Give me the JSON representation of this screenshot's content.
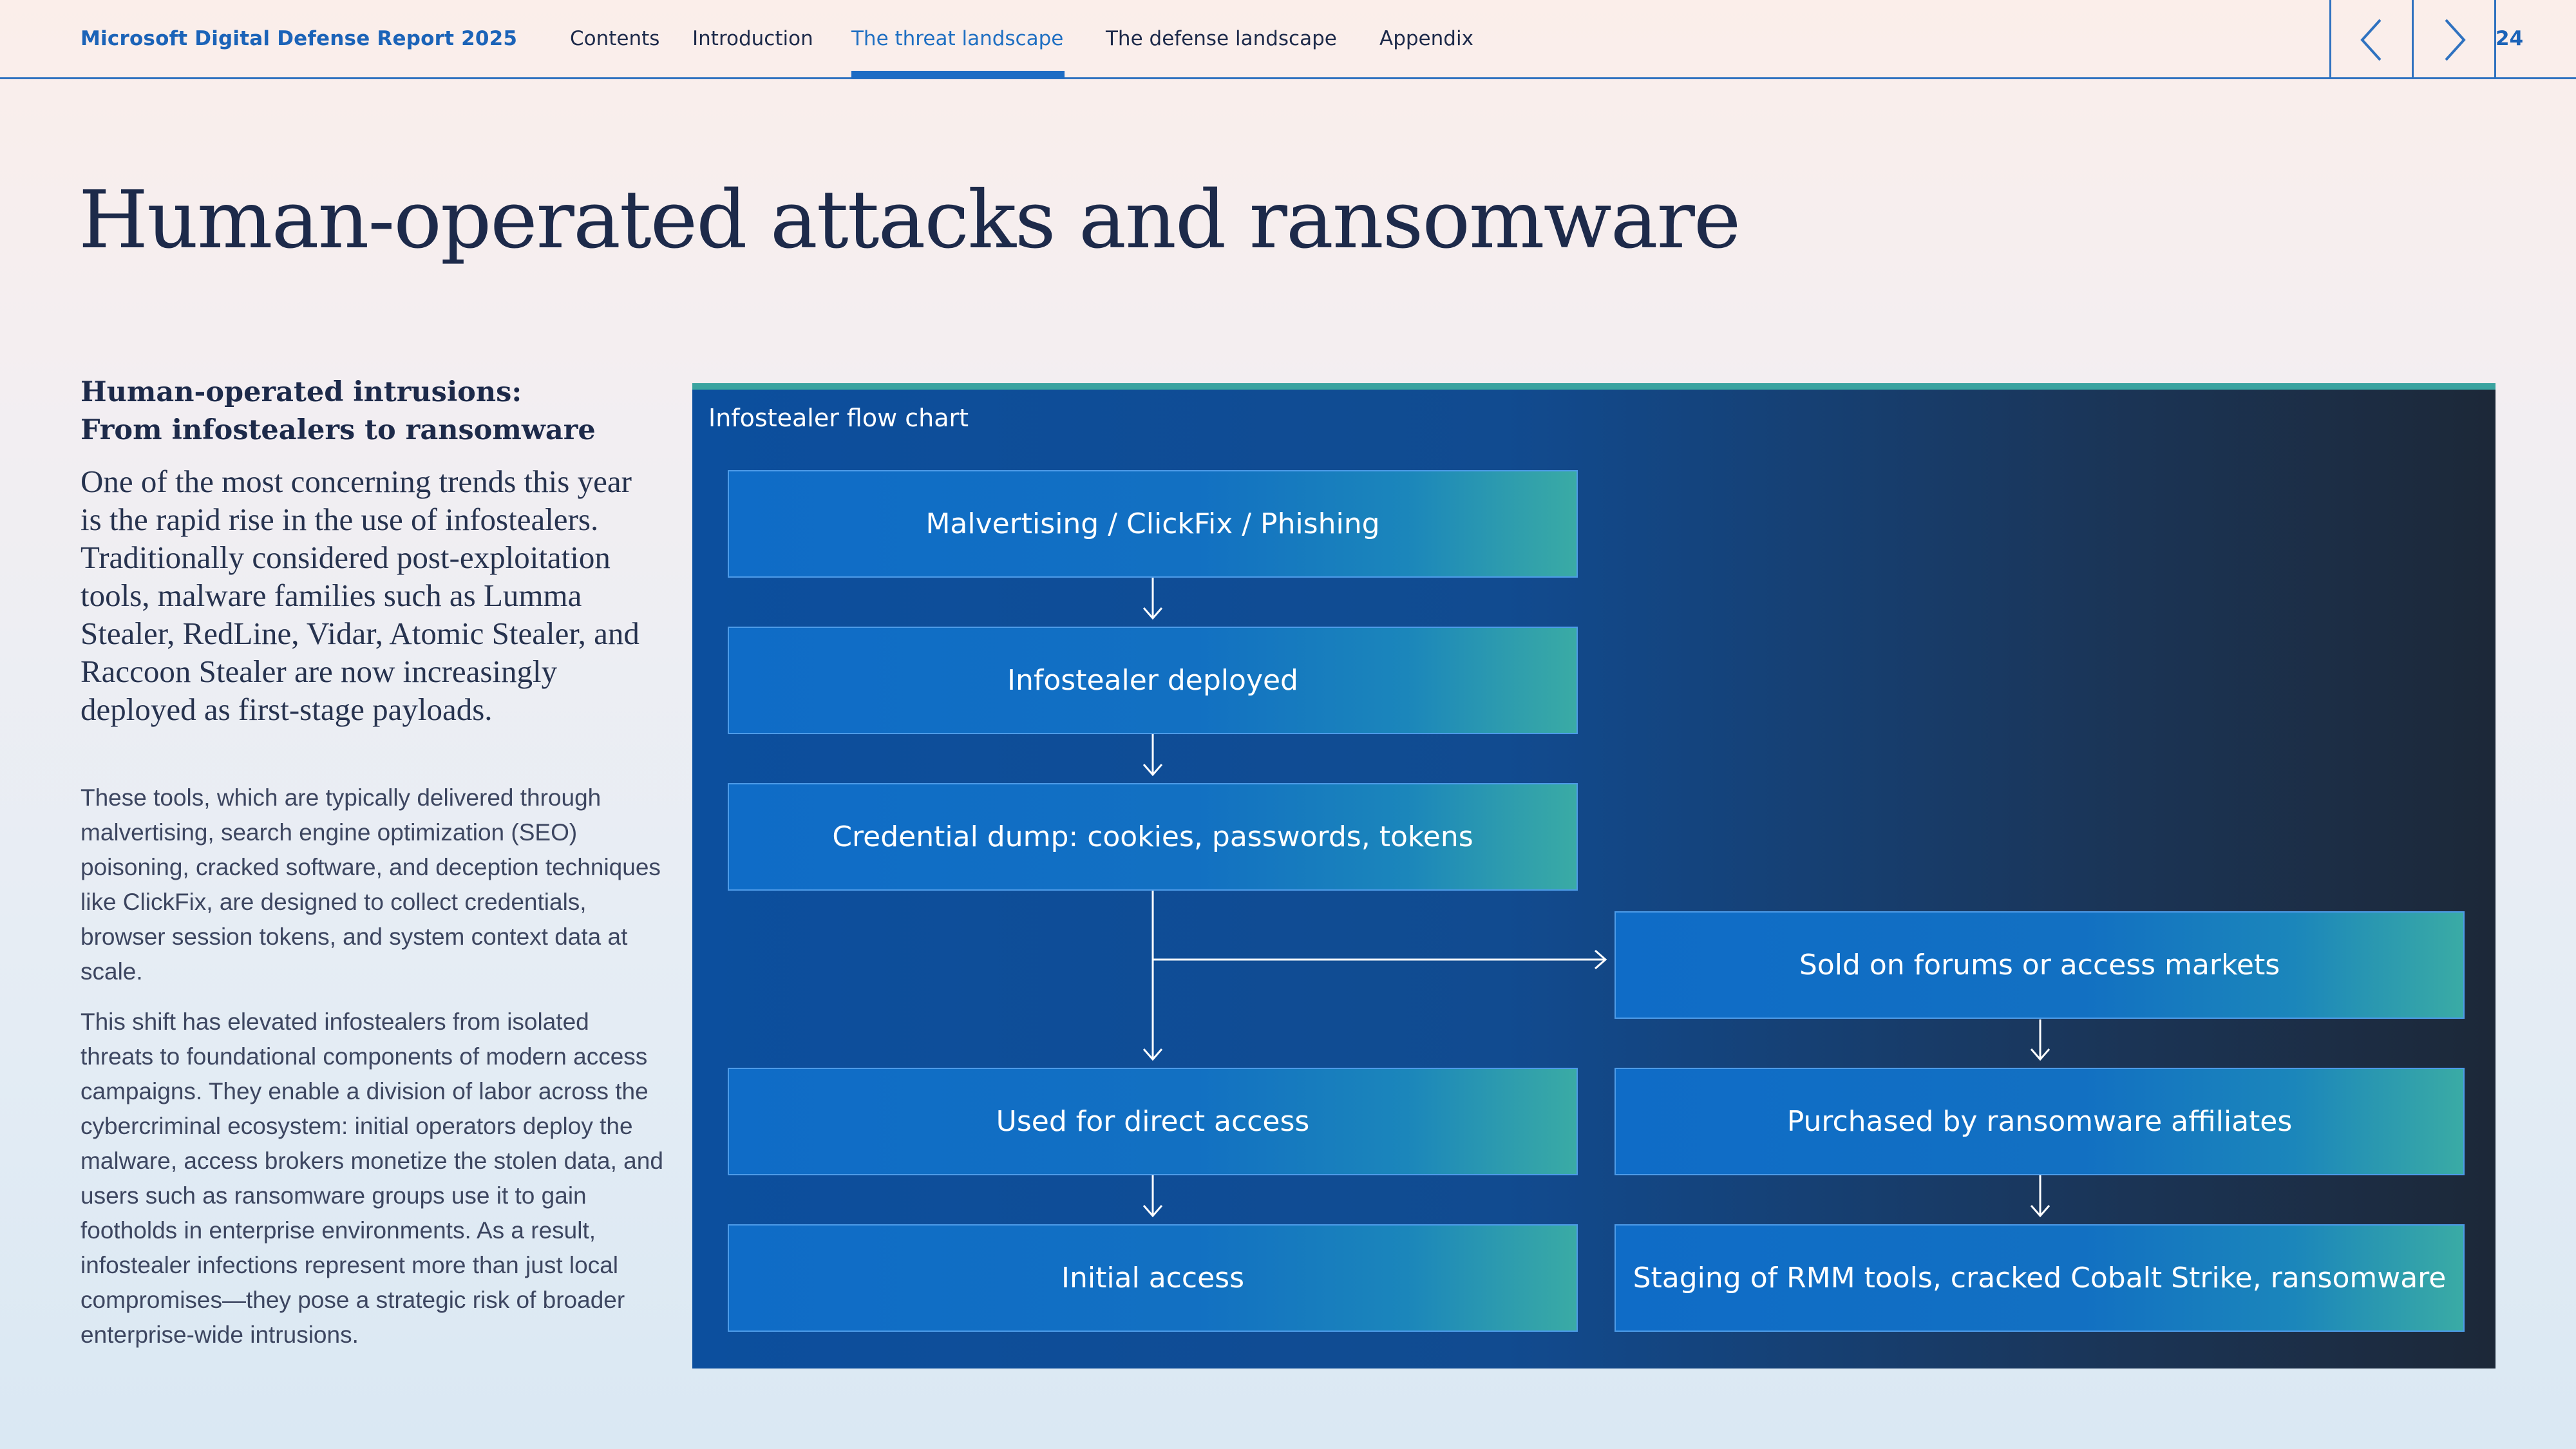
{
  "nav": {
    "brand": "Microsoft Digital Defense Report 2025",
    "items": [
      {
        "label": "Contents"
      },
      {
        "label": "Introduction"
      },
      {
        "label": "The threat landscape"
      },
      {
        "label": "The defense landscape"
      },
      {
        "label": "Appendix"
      }
    ],
    "active_item": "The threat landscape",
    "page_number": "24",
    "prev_icon": "chevron-left-icon",
    "next_icon": "chevron-right-icon"
  },
  "page_title": "Human-operated attacks and ransomware",
  "subhead": {
    "line1": "Human-operated intrusions:",
    "line2": "From infostealers to ransomware"
  },
  "lead_paragraph": "One of the most concerning trends this year is the rapid rise in the use of infostealers. Traditionally considered post-exploitation tools, malware families such as Lumma Stealer, RedLine, Vidar, Atomic Stealer, and Raccoon Stealer are now increasingly deployed as first-stage payloads.",
  "body_paragraphs": [
    "These tools, which are typically delivered through malvertising, search engine optimization (SEO) poisoning, cracked software, and deception techniques like ClickFix, are designed to collect credentials, browser session tokens, and system context data at scale.",
    "This shift has elevated infostealers from isolated threats to foundational components of modern access campaigns. They enable a division of labor across the cybercriminal ecosystem: initial operators deploy the malware, access brokers monetize the stolen data, and users such as ransomware groups use it to gain footholds in enterprise environments. As a result, infostealer infections represent more than just local compromises—they pose a strategic risk of broader enterprise-wide intrusions."
  ],
  "flowchart": {
    "title": "Infostealer flow chart",
    "nodes": {
      "malvertising": "Malvertising / ClickFix / Phishing",
      "deployed": "Infostealer deployed",
      "credential_dump": "Credential dump: cookies, passwords, tokens",
      "direct_access": "Used for direct access",
      "initial_access": "Initial access",
      "sold_forums": "Sold on forums or access markets",
      "purchased": "Purchased by ransomware affiliates",
      "staging": "Staging of RMM tools, cracked Cobalt Strike, ransomware"
    }
  },
  "colors": {
    "accent_blue": "#1b63b8",
    "panel_dark": "#1c2838",
    "teal_accent": "#3aa3a0",
    "title_text": "#1d2a4a"
  }
}
